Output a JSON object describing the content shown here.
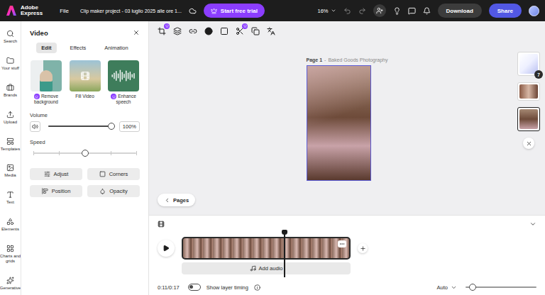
{
  "app": {
    "brand_line1": "Adobe",
    "brand_line2": "Express"
  },
  "top_bar": {
    "menu": "File",
    "document_title": "Clip maker project - 03 luglio 2025 alle ore 1...",
    "trial_button": "Start free trial",
    "zoom": "16%",
    "download_button": "Download",
    "share_button": "Share"
  },
  "sidebar": {
    "items": [
      {
        "label": "Search"
      },
      {
        "label": "Your stuff"
      },
      {
        "label": "Brands"
      },
      {
        "label": "Upload"
      },
      {
        "label": "Templates"
      },
      {
        "label": "Media"
      },
      {
        "label": "Text"
      },
      {
        "label": "Elements"
      },
      {
        "label": "Charts and grids"
      },
      {
        "label": "Generative"
      }
    ]
  },
  "panel": {
    "title": "Video",
    "tabs": [
      {
        "label": "Edit",
        "selected": true
      },
      {
        "label": "Effects",
        "selected": false
      },
      {
        "label": "Animation",
        "selected": false
      }
    ],
    "quick_actions": [
      {
        "label": "Remove background",
        "premium": true,
        "kind": "cutout"
      },
      {
        "label": "Fill Video",
        "premium": false,
        "kind": "fill"
      },
      {
        "label": "Enhance speech",
        "premium": true,
        "kind": "speech"
      }
    ],
    "volume": {
      "label": "Volume",
      "level": 1,
      "reading": "100%"
    },
    "speed": {
      "label": "Speed",
      "level": 0.5
    },
    "buttons": [
      "Adjust",
      "Corners",
      "Position",
      "Opacity"
    ]
  },
  "toolbar": {
    "tools": [
      {
        "premium": true
      },
      {
        "premium": false
      },
      {
        "premium": false
      },
      {
        "premium": false
      },
      {
        "premium": false
      },
      {
        "premium": true
      },
      {
        "premium": false
      },
      {
        "premium": false
      }
    ]
  },
  "canvas": {
    "page_label": "Page 1",
    "separator": "-",
    "page_title": "Baked Goods Photography"
  },
  "pages": {
    "count_badge": "7",
    "thumbnails": [
      {
        "kind": "card",
        "selected": false
      },
      {
        "kind": "landscape",
        "selected": false
      },
      {
        "kind": "portrait",
        "selected": true
      }
    ],
    "button": "Pages"
  },
  "timeline": {
    "playhead": 0.606,
    "add_audio": "Add audio",
    "time": "0:11/0:17",
    "layer_timing": {
      "label": "Show layer timing",
      "on": false
    },
    "zoom_mode": "Auto",
    "zoom_level": 0.1
  }
}
